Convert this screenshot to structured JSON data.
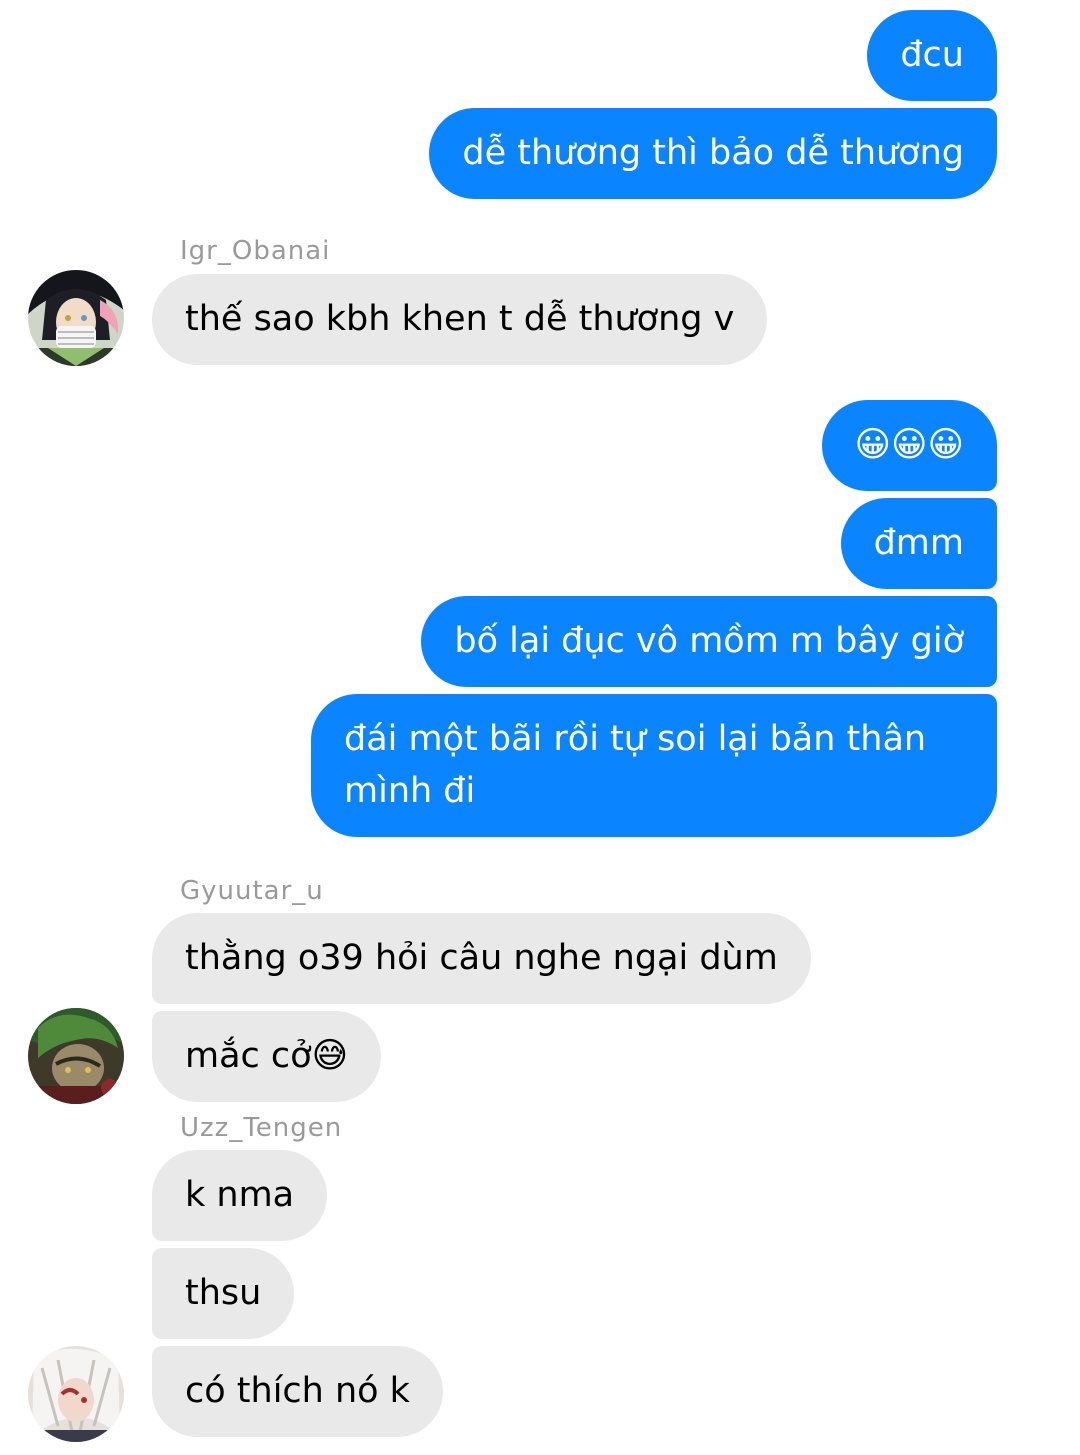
{
  "messages": {
    "m1": "đcu",
    "m2": "dễ thương thì bảo dễ thương",
    "m3": "thế sao kbh khen t dễ thương v",
    "m4": "😀😀😀",
    "m5": "đmm",
    "m6": "bố lại đục vô mồm m bây giờ",
    "m7": "đái một bãi rồi tự soi lại bản thân mình đi",
    "m8": "thằng o39 hỏi câu nghe ngại dùm",
    "m9": "mắc cở😅",
    "m10": "k nma",
    "m11": "thsu",
    "m12": "có thích nó k"
  },
  "senders": {
    "obanai": "Igr_Obanai",
    "gyuutar": "Gyuutar_u",
    "tengen": "Uzz_Tengen"
  },
  "colors": {
    "outgoing_bubble": "#0a84ff",
    "incoming_bubble": "#e9e9e9",
    "sender_name": "#9a9a9a"
  },
  "icons": {
    "avatar_obanai": "avatar-obanai-icon",
    "avatar_gyuutar": "avatar-gyuutar-icon",
    "avatar_tengen": "avatar-tengen-icon"
  }
}
